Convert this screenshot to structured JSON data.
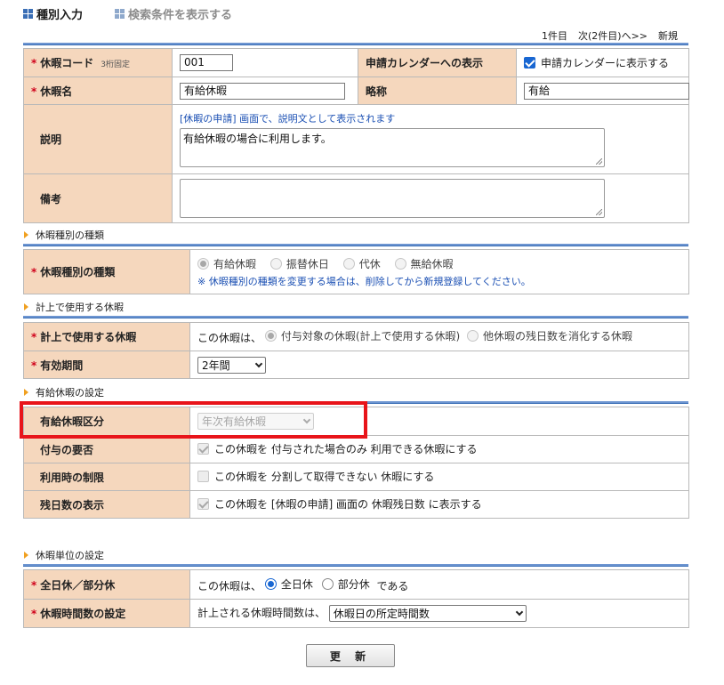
{
  "nav": {
    "tab1": "種別入力",
    "tab2": "検索条件を表示する"
  },
  "pager": {
    "count": "1件目",
    "next": "次(2件目)へ>>",
    "new": "新規"
  },
  "basic": {
    "code_label": "休暇コード",
    "code_note": "3桁固定",
    "code_value": "001",
    "calendar_label": "申請カレンダーへの表示",
    "calendar_option": "申請カレンダーに表示する",
    "name_label": "休暇名",
    "name_value": "有給休暇",
    "abbr_label": "略称",
    "abbr_value": "有給",
    "desc_label": "説明",
    "desc_hint": "[休暇の申請] 画面で、説明文として表示されます",
    "desc_value": "有給休暇の場合に利用します。",
    "remarks_label": "備考",
    "remarks_value": ""
  },
  "sections": {
    "type": "休暇種別の種類",
    "accounting": "計上で使用する休暇",
    "paid": "有給休暇の設定",
    "unit": "休暇単位の設定"
  },
  "type": {
    "label": "休暇種別の種類",
    "options": [
      "有給休暇",
      "振替休日",
      "代休",
      "無給休暇"
    ],
    "note": "※ 休暇種別の種類を変更する場合は、削除してから新規登録してください。"
  },
  "accounting": {
    "label": "計上で使用する休暇",
    "prefix": "この休暇は、",
    "opt1": "付与対象の休暇(計上で使用する休暇)",
    "opt2": "他休暇の残日数を消化する休暇",
    "period_label": "有効期間",
    "period_value": "2年間"
  },
  "paid": {
    "category_label": "有給休暇区分",
    "category_value": "年次有給休暇",
    "grant_label": "付与の要否",
    "grant_text": "この休暇を 付与された場合のみ 利用できる休暇にする",
    "limit_label": "利用時の制限",
    "limit_text": "この休暇を 分割して取得できない 休暇にする",
    "remain_label": "残日数の表示",
    "remain_text": "この休暇を [休暇の申請] 画面の 休暇残日数 に表示する"
  },
  "unit": {
    "day_label": "全日休／部分休",
    "day_prefix": "この休暇は、",
    "day_opt1": "全日休",
    "day_opt2": "部分休",
    "day_suffix": "である",
    "hours_label": "休暇時間数の設定",
    "hours_prefix": "計上される休暇時間数は、",
    "hours_value": "休暇日の所定時間数"
  },
  "submit_label": "更 新"
}
